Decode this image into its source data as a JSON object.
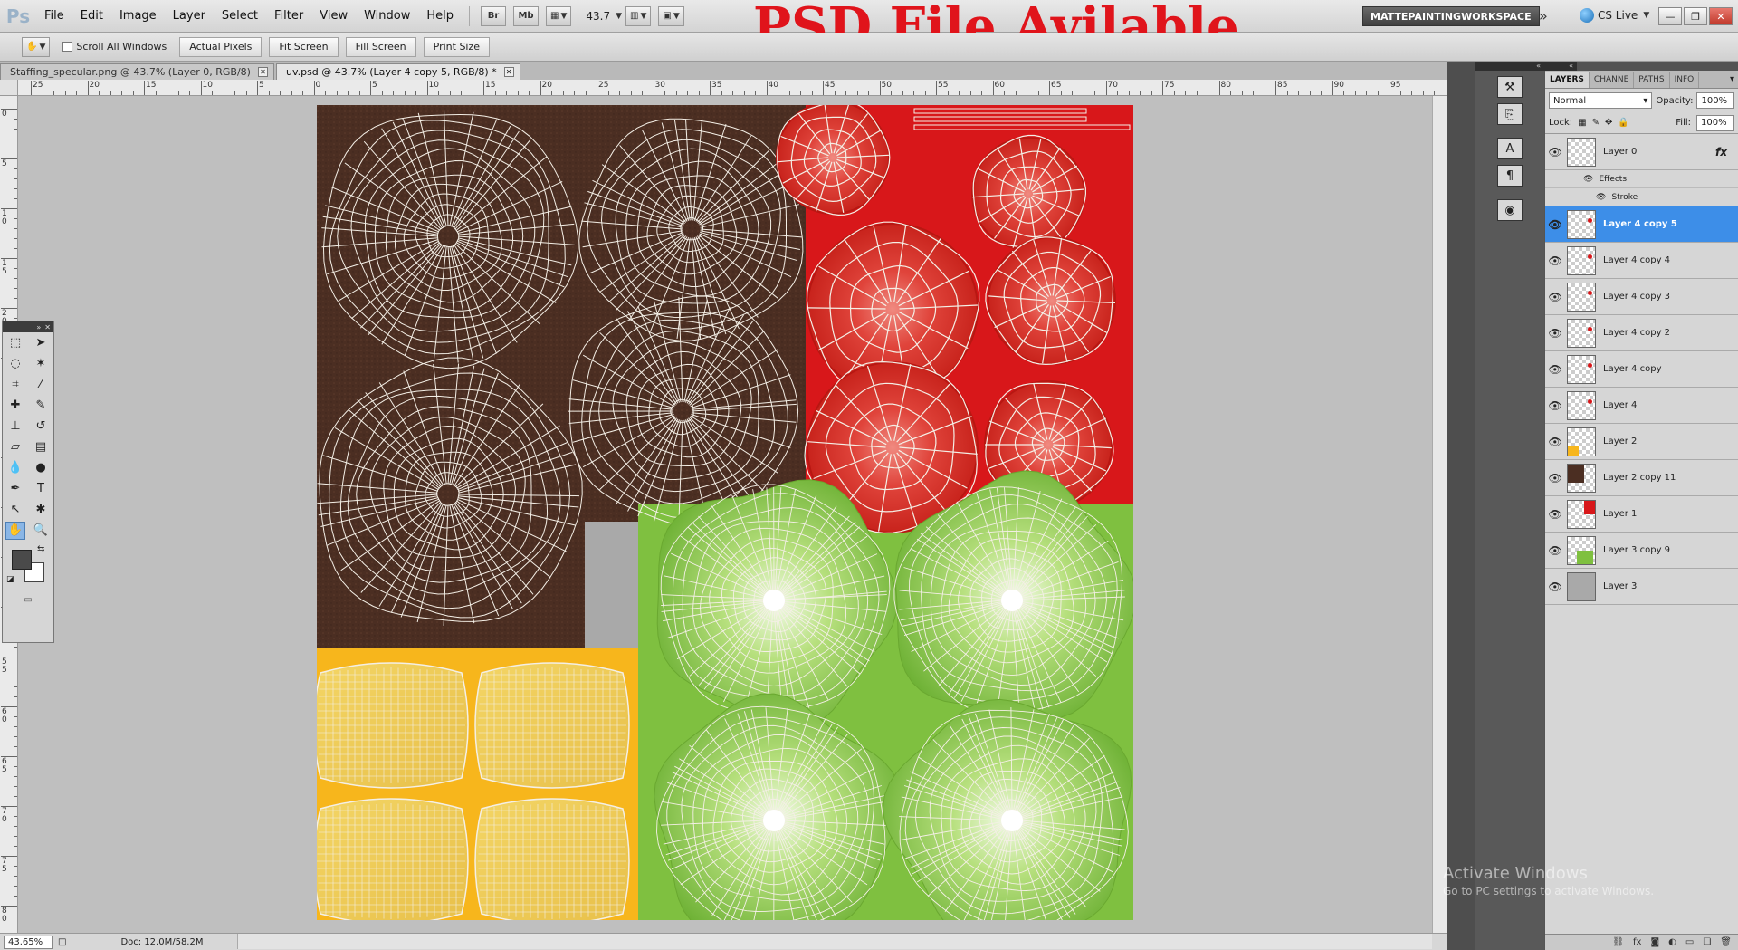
{
  "app": {
    "logo": "Ps"
  },
  "menu": [
    "File",
    "Edit",
    "Image",
    "Layer",
    "Select",
    "Filter",
    "View",
    "Window",
    "Help"
  ],
  "menubar": {
    "bridge_label": "Br",
    "minibridge_label": "Mb",
    "zoom": "43.7",
    "banner": "PSD File Avilable",
    "workspace": "MATTEPAINTINGWORKSPACE",
    "cslive": "CS Live"
  },
  "options": {
    "scroll_all": "Scroll All Windows",
    "buttons": [
      "Actual Pixels",
      "Fit Screen",
      "Fill Screen",
      "Print Size"
    ]
  },
  "tabs": [
    {
      "label": "Staffing_specular.png @ 43.7% (Layer 0, RGB/8)",
      "active": false
    },
    {
      "label": "uv.psd @ 43.7% (Layer 4 copy 5, RGB/8) *",
      "active": true
    }
  ],
  "ruler": {
    "h_labels": [
      "25",
      "20",
      "15",
      "10",
      "5",
      "0",
      "5",
      "10",
      "15",
      "20",
      "25",
      "30",
      "35",
      "40",
      "45",
      "50",
      "55",
      "60",
      "65",
      "70",
      "75",
      "80",
      "85",
      "90",
      "95"
    ],
    "v_labels": [
      "0",
      "5",
      "1 0",
      "1 5",
      "2 0",
      "2 5",
      "3 0",
      "3 5",
      "4 0",
      "4 5",
      "5 0",
      "5 5",
      "6 0",
      "6 5",
      "7 0",
      "7 5",
      "8 0"
    ]
  },
  "status": {
    "zoom": "43.65%",
    "doc": "Doc: 12.0M/58.2M"
  },
  "panel": {
    "tabs": [
      "LAYERS",
      "CHANNE",
      "PATHS",
      "INFO"
    ],
    "blend_mode": "Normal",
    "opacity_label": "Opacity:",
    "opacity": "100%",
    "lock_label": "Lock:",
    "fill_label": "Fill:",
    "fill": "100%",
    "effects_label": "Effects",
    "stroke_label": "Stroke",
    "fx_label": "fx"
  },
  "layers": [
    {
      "name": "Layer 0",
      "selected": false,
      "mark": "none"
    },
    {
      "name": "Layer 4 copy 5",
      "selected": true,
      "mark": "red-dot"
    },
    {
      "name": "Layer 4 copy 4",
      "selected": false,
      "mark": "red-dot"
    },
    {
      "name": "Layer 4 copy 3",
      "selected": false,
      "mark": "red-dot"
    },
    {
      "name": "Layer 4 copy 2",
      "selected": false,
      "mark": "red-dot"
    },
    {
      "name": "Layer 4 copy",
      "selected": false,
      "mark": "red-dot"
    },
    {
      "name": "Layer 4",
      "selected": false,
      "mark": "red-dot"
    },
    {
      "name": "Layer 2",
      "selected": false,
      "mark": "yellow"
    },
    {
      "name": "Layer 2 copy 11",
      "selected": false,
      "mark": "brown"
    },
    {
      "name": "Layer 1",
      "selected": false,
      "mark": "red"
    },
    {
      "name": "Layer 3 copy 9",
      "selected": false,
      "mark": "green"
    },
    {
      "name": "Layer 3",
      "selected": false,
      "mark": "gray"
    }
  ],
  "watermark": {
    "line1": "Activate Windows",
    "line2": "Go to PC settings to activate Windows."
  },
  "colors": {
    "brown": "#4b2e22",
    "red": "#d8171a",
    "yellow": "#f7b61c",
    "gray": "#a9a9a9",
    "green": "#7fc040",
    "wire": "#f4efe6",
    "selection": "#3d8ee8"
  },
  "icons": {
    "hand_tool": "hand-icon",
    "marquee": "marquee-icon",
    "move": "move-icon",
    "lasso": "lasso-icon",
    "magic_wand": "magic-wand-icon",
    "crop": "crop-icon",
    "eyedropper": "eyedropper-icon",
    "brush": "brush-icon",
    "stamp": "stamp-icon",
    "eraser": "eraser-icon",
    "gradient": "gradient-icon",
    "blur": "blur-icon",
    "dodge": "dodge-icon",
    "pen": "pen-icon",
    "type": "type-icon",
    "path_select": "path-select-icon",
    "shape": "shape-icon",
    "zoom": "zoom-icon"
  }
}
